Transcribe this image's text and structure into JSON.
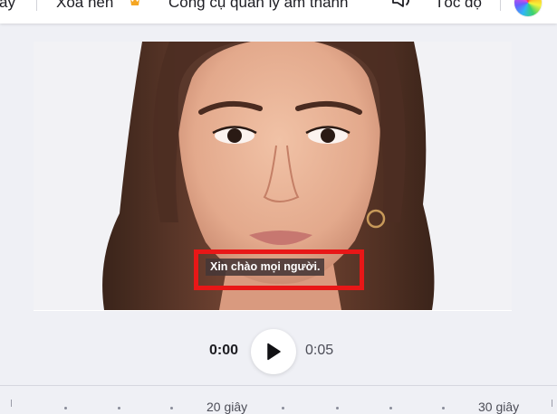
{
  "toolbar": {
    "item_partial": "ay",
    "remove_bg_label": "Xóa nền",
    "audio_tools_label": "Công cụ quản lý âm thanh",
    "speed_label": "Tốc độ"
  },
  "icons": [
    "crown-icon",
    "speaker-icon",
    "color-wheel-icon",
    "play-icon"
  ],
  "colors": {
    "caption_highlight_border": "#e81717",
    "caption_background": "#463737",
    "canvas_background": "#eff0f5",
    "pro_crown": "#f5a623"
  },
  "video": {
    "caption_text": "Xin chào mọi người."
  },
  "player": {
    "current_time": "0:00",
    "total_time": "0:05"
  },
  "timeline": {
    "label_20": "20 giây",
    "label_30": "30 giây"
  }
}
